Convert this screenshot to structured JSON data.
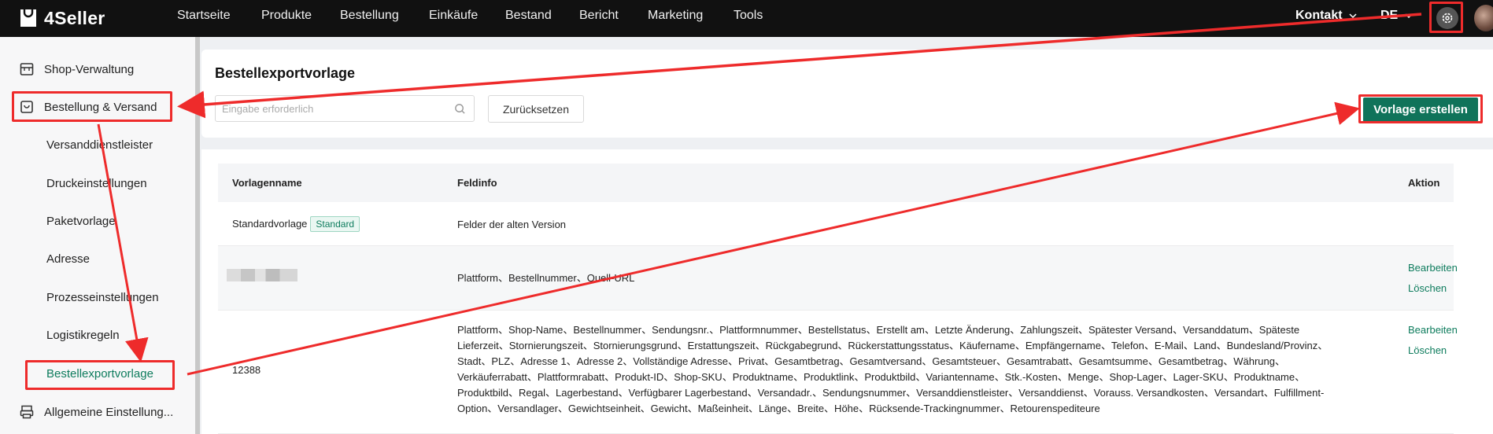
{
  "brand": {
    "name": "4Seller"
  },
  "nav": {
    "items": [
      "Startseite",
      "Produkte",
      "Bestellung",
      "Einkäufe",
      "Bestand",
      "Bericht",
      "Marketing",
      "Tools"
    ],
    "contact": "Kontakt",
    "language": "DE"
  },
  "sidebar": {
    "shop": "Shop-Verwaltung",
    "order": "Bestellung & Versand",
    "subitems": [
      "Versanddienstleister",
      "Druckeinstellungen",
      "Paketvorlage",
      "Adresse",
      "Prozesseinstellungen",
      "Logistikregeln",
      "Bestellexportvorlage"
    ],
    "general": "Allgemeine Einstellung..."
  },
  "page": {
    "title": "Bestellexportvorlage",
    "search_placeholder": "Eingabe erforderlich",
    "reset_label": "Zurücksetzen",
    "create_label": "Vorlage erstellen"
  },
  "table": {
    "headers": [
      "Vorlagenname",
      "Feldinfo",
      "Aktion"
    ],
    "rows": [
      {
        "name": "Standardvorlage",
        "tag": "Standard",
        "fields": "Felder der alten Version"
      },
      {
        "name": "",
        "fields": "Plattform、Bestellnummer、Quell-URL",
        "edit": "Bearbeiten",
        "delete": "Löschen"
      },
      {
        "name": "12388",
        "fields_lines": [
          "Plattform、Shop-Name、Bestellnummer、Sendungsnr.、Plattformnummer、Bestellstatus、Erstellt am、Letzte Änderung、Zahlungszeit、Spätester Versand、Versanddatum、Späteste",
          "Lieferzeit、Stornierungszeit、Stornierungsgrund、Erstattungszeit、Rückgabegrund、Rückerstattungsstatus、Käufername、Empfängername、Telefon、E-Mail、Land、Bundesland/Provinz、",
          "Stadt、PLZ、Adresse 1、Adresse 2、Vollständige Adresse、Privat、Gesamtbetrag、Gesamtversand、Gesamtsteuer、Gesamtrabatt、Gesamtsumme、Gesamtbetrag、Währung、",
          "Verkäuferrabatt、Plattformrabatt、Produkt-ID、Shop-SKU、Produktname、Produktlink、Produktbild、Variantenname、Stk.-Kosten、Menge、Shop-Lager、Lager-SKU、Produktname、",
          "Produktbild、Regal、Lagerbestand、Verfügbarer Lagerbestand、Versandadr.、Sendungsnummer、Versanddienstleister、Versanddienst、Vorauss. Versandkosten、Versandart、Fulfillment-",
          "Option、Versandlager、Gewichtseinheit、Gewicht、Maßeinheit、Länge、Breite、Höhe、Rücksende-Trackingnummer、Retourenspediteure"
        ],
        "edit": "Bearbeiten",
        "delete": "Löschen"
      }
    ]
  },
  "colors": {
    "accent": "#10735a",
    "annotation": "#ee2b2b",
    "topbar": "#111111"
  }
}
